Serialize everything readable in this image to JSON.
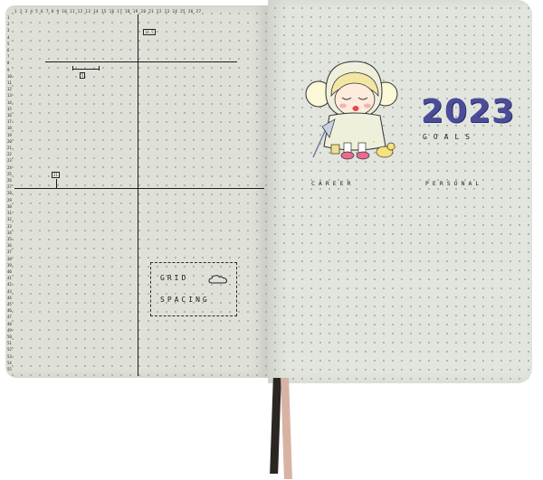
{
  "left_page": {
    "top_ruler": "1 2 3 4 5 6 7 8 9 10 11 12 13 14 15 16 17 18 19 20 21 22 23 24 25 26 27",
    "left_ruler": [
      "1",
      "2",
      "3",
      "4",
      "5",
      "6",
      "7",
      "8",
      "9",
      "10",
      "11",
      "12",
      "13",
      "14",
      "15",
      "16",
      "17",
      "18",
      "19",
      "20",
      "21",
      "22",
      "23",
      "24",
      "25",
      "26",
      "27",
      "28",
      "29",
      "30",
      "31",
      "32",
      "33",
      "34",
      "35",
      "36",
      "37",
      "38",
      "39",
      "40",
      "41",
      "42",
      "43",
      "44",
      "45",
      "46",
      "47",
      "48",
      "49",
      "50",
      "51",
      "52",
      "53",
      "54",
      "55"
    ],
    "label_top_right": "14.5",
    "label_mid": "5",
    "label_side": "21",
    "grid_box_line1": "GRID",
    "grid_box_line2": "SPACING"
  },
  "right_page": {
    "year": "2023",
    "subtitle": "GOALS",
    "section_left": "CAREER",
    "section_right": "PERSONAL"
  },
  "colors": {
    "page": "#e2e5de",
    "ink": "#1d1d1d",
    "year_fill": "#4b4d98"
  }
}
